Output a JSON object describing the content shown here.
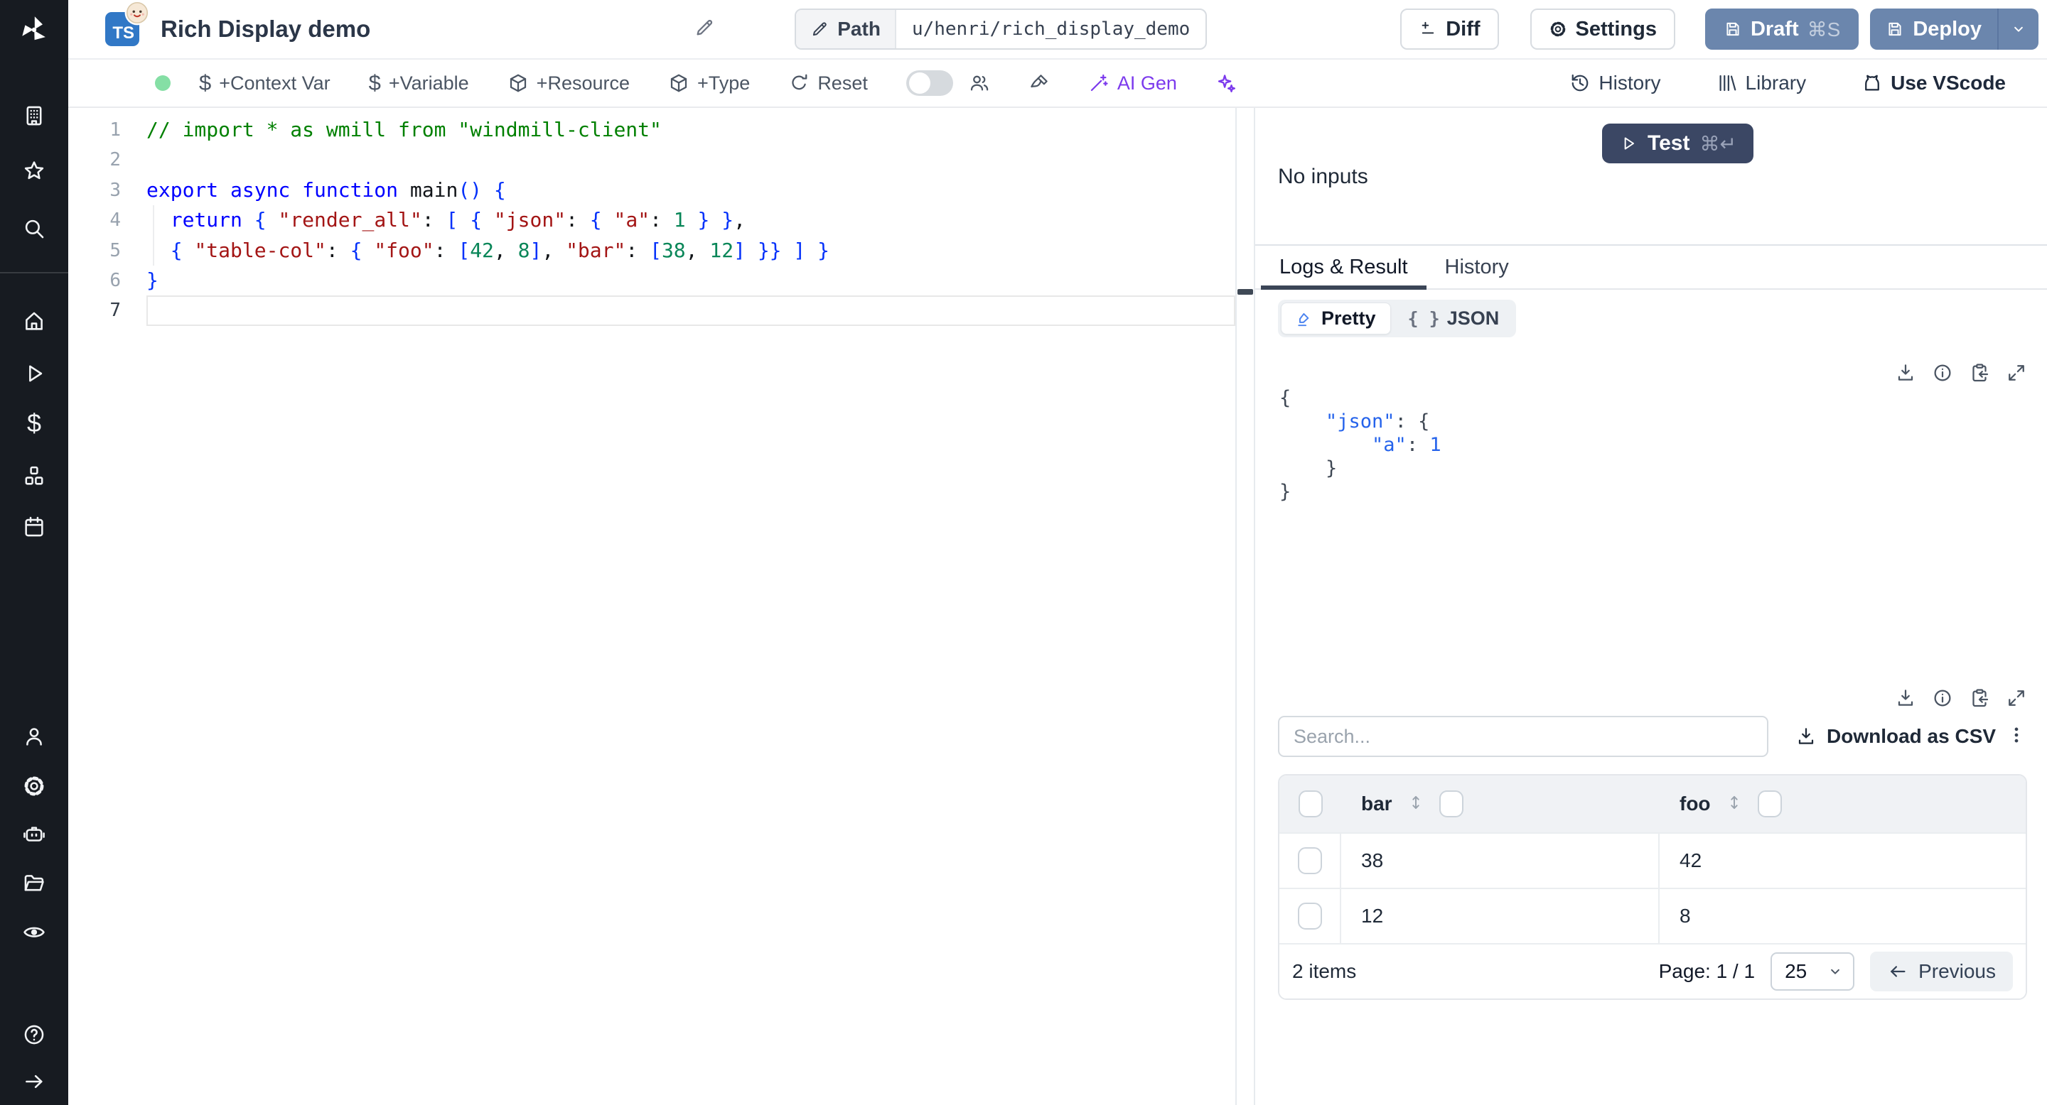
{
  "header": {
    "language_badge": "TS",
    "title": "Rich Display demo",
    "path_label": "Path",
    "path_value": "u/henri/rich_display_demo",
    "buttons": {
      "diff": "Diff",
      "settings": "Settings",
      "draft": "Draft",
      "draft_shortcut": "⌘S",
      "deploy": "Deploy"
    }
  },
  "toolbar": {
    "add_context_var": "+Context Var",
    "add_variable": "+Variable",
    "add_resource": "+Resource",
    "add_type": "+Type",
    "reset": "Reset",
    "ai_gen": "AI Gen",
    "history": "History",
    "library": "Library",
    "use_vscode": "Use VScode"
  },
  "sidebar": {
    "icons": [
      "windmill-logo",
      "workspace-building",
      "favorites-star",
      "search",
      "home",
      "runs-play",
      "variables-dollar",
      "resources-cubes",
      "schedules-calendar",
      "user",
      "settings-gear",
      "workers-robot",
      "folders",
      "audit-eye",
      "help",
      "expand-arrow"
    ]
  },
  "colors": {
    "steel_button": "#6b86ad",
    "navy_test_button": "#3b4764",
    "ai_purple": "#7c3aed",
    "green_status_dot": "#85dfa5",
    "ts_badge_blue": "#3178c6"
  },
  "editor": {
    "active_line": 7,
    "lines": [
      [
        [
          "cmt",
          "// import * as wmill from \"windmill-client\""
        ]
      ],
      [],
      [
        [
          "kw",
          "export async function "
        ],
        [
          "fn",
          "main"
        ],
        [
          "br",
          "() {"
        ]
      ],
      [
        [
          "pl",
          "  "
        ],
        [
          "kw",
          "return"
        ],
        [
          "pl",
          " "
        ],
        [
          "br",
          "{"
        ],
        [
          "pl",
          " "
        ],
        [
          "str",
          "\"render_all\""
        ],
        [
          "pl",
          ": "
        ],
        [
          "br",
          "["
        ],
        [
          "pl",
          " "
        ],
        [
          "br",
          "{"
        ],
        [
          "pl",
          " "
        ],
        [
          "str",
          "\"json\""
        ],
        [
          "pl",
          ": "
        ],
        [
          "br",
          "{"
        ],
        [
          "pl",
          " "
        ],
        [
          "str",
          "\"a\""
        ],
        [
          "pl",
          ": "
        ],
        [
          "num",
          "1"
        ],
        [
          "pl",
          " "
        ],
        [
          "br",
          "} }"
        ],
        [
          "pl",
          ","
        ]
      ],
      [
        [
          "pl",
          "  "
        ],
        [
          "br",
          "{"
        ],
        [
          "pl",
          " "
        ],
        [
          "str",
          "\"table-col\""
        ],
        [
          "pl",
          ": "
        ],
        [
          "br",
          "{"
        ],
        [
          "pl",
          " "
        ],
        [
          "str",
          "\"foo\""
        ],
        [
          "pl",
          ": "
        ],
        [
          "br",
          "["
        ],
        [
          "num",
          "42"
        ],
        [
          "pl",
          ", "
        ],
        [
          "num",
          "8"
        ],
        [
          "br",
          "]"
        ],
        [
          "pl",
          ", "
        ],
        [
          "str",
          "\"bar\""
        ],
        [
          "pl",
          ": "
        ],
        [
          "br",
          "["
        ],
        [
          "num",
          "38"
        ],
        [
          "pl",
          ", "
        ],
        [
          "num",
          "12"
        ],
        [
          "br",
          "]"
        ],
        [
          "pl",
          " "
        ],
        [
          "br",
          "}} ] }"
        ]
      ],
      [
        [
          "br",
          "}"
        ]
      ],
      []
    ]
  },
  "run_panel": {
    "test_label": "Test",
    "test_shortcut": "⌘↵",
    "no_inputs_text": "No inputs",
    "tabs": [
      {
        "label": "Logs & Result"
      },
      {
        "label": "History"
      }
    ],
    "view_toggle": {
      "pretty": "Pretty",
      "json": "JSON"
    },
    "result_json_lines": [
      [
        [
          "jbr",
          "{"
        ]
      ],
      [
        [
          "jpl",
          "    "
        ],
        [
          "jkey",
          "\"json\""
        ],
        [
          "jpl",
          ": "
        ],
        [
          "jbr",
          "{"
        ]
      ],
      [
        [
          "jpl",
          "        "
        ],
        [
          "jkey",
          "\"a\""
        ],
        [
          "jpl",
          ": "
        ],
        [
          "jnum",
          "1"
        ]
      ],
      [
        [
          "jpl",
          "    "
        ],
        [
          "jbr",
          "}"
        ]
      ],
      [
        [
          "jbr",
          "}"
        ]
      ]
    ],
    "table": {
      "search_placeholder": "Search...",
      "download_csv": "Download as CSV",
      "columns": [
        "bar",
        "foo"
      ],
      "rows": [
        [
          "38",
          "42"
        ],
        [
          "12",
          "8"
        ]
      ],
      "items_text": "2 items",
      "page_text": "Page: 1 / 1",
      "page_size": "25",
      "previous_label": "Previous"
    }
  }
}
